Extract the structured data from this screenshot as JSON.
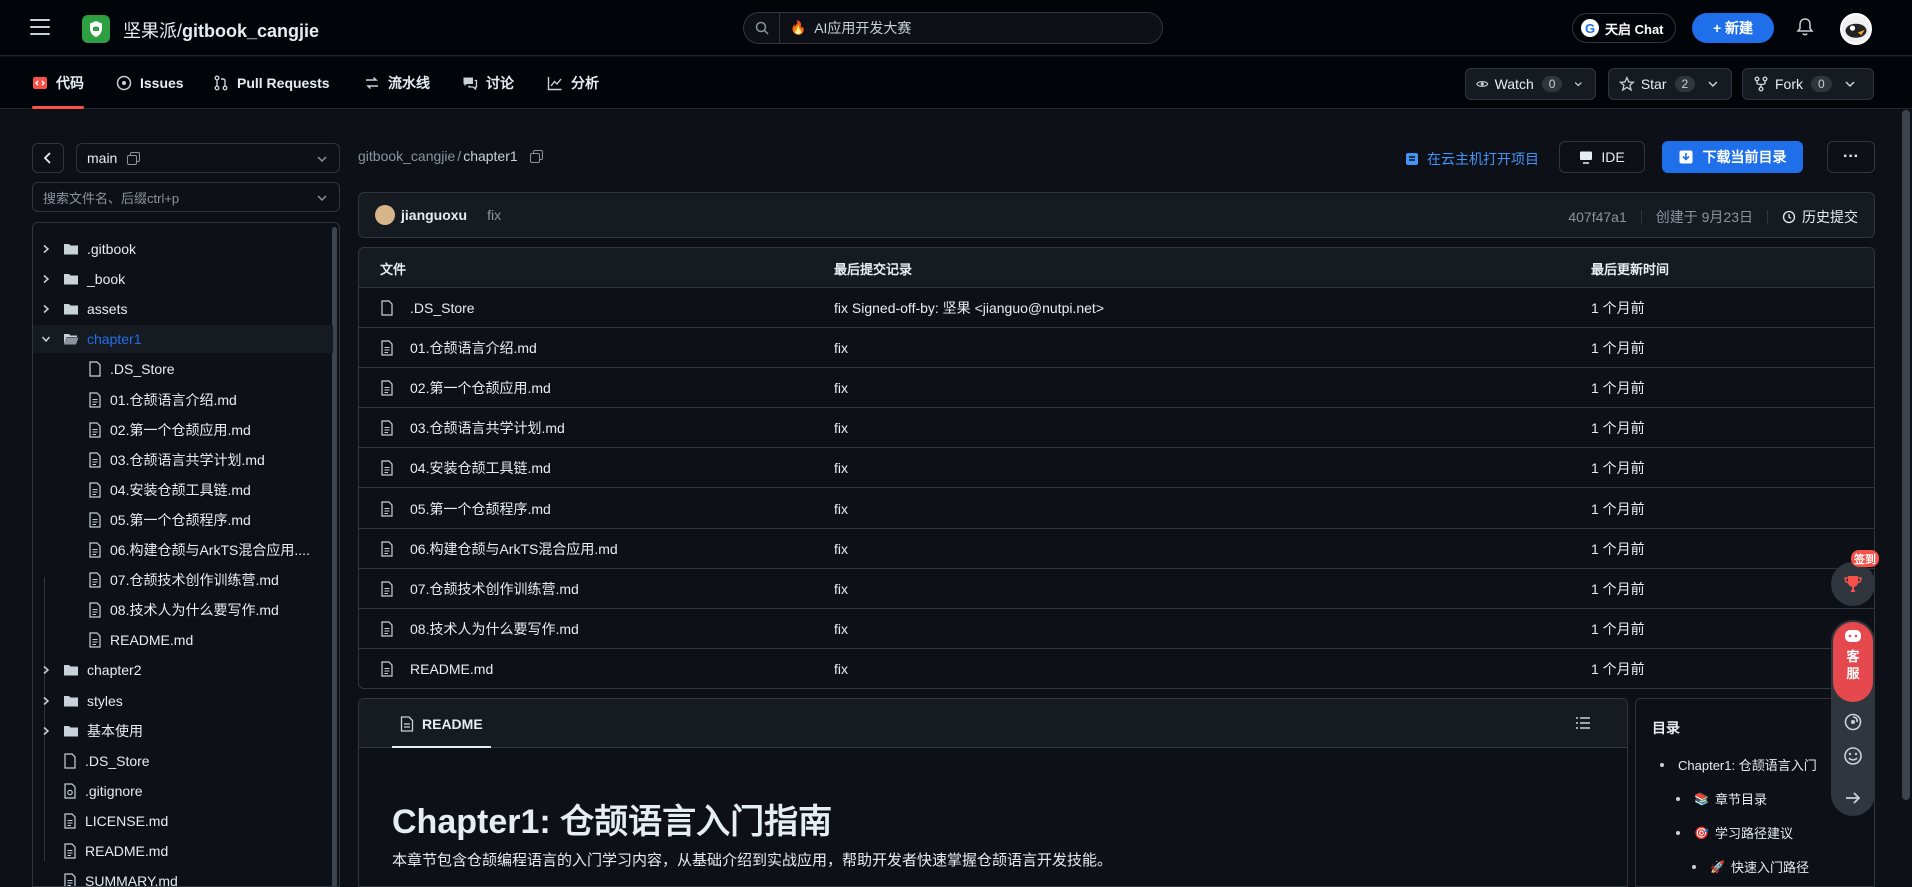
{
  "header": {
    "org": "坚果派",
    "slash": "/",
    "repo": "gitbook_cangjie",
    "search_placeholder": "AI应用开发大赛",
    "chat_label": "天启 Chat",
    "new_label": "+ 新建"
  },
  "subnav": {
    "tabs": [
      {
        "label": "代码",
        "active": true
      },
      {
        "label": "Issues"
      },
      {
        "label": "Pull Requests"
      },
      {
        "label": "流水线"
      },
      {
        "label": "讨论"
      },
      {
        "label": "分析"
      }
    ],
    "watch": {
      "label": "Watch",
      "count": "0"
    },
    "star": {
      "label": "Star",
      "count": "2"
    },
    "fork": {
      "label": "Fork",
      "count": "0"
    }
  },
  "sidebar": {
    "branch": "main",
    "file_search_placeholder": "搜索文件名、后缀ctrl+p",
    "tree": [
      {
        "label": ".gitbook",
        "type": "folder",
        "expanded": false,
        "depth": 0
      },
      {
        "label": "_book",
        "type": "folder",
        "expanded": false,
        "depth": 0
      },
      {
        "label": "assets",
        "type": "folder",
        "expanded": false,
        "depth": 0
      },
      {
        "label": "chapter1",
        "type": "folder",
        "expanded": true,
        "depth": 0
      },
      {
        "label": ".DS_Store",
        "type": "file",
        "depth": 1
      },
      {
        "label": "01.仓颉语言介绍.md",
        "type": "md",
        "depth": 1
      },
      {
        "label": "02.第一个仓颉应用.md",
        "type": "md",
        "depth": 1
      },
      {
        "label": "03.仓颉语言共学计划.md",
        "type": "md",
        "depth": 1
      },
      {
        "label": "04.安装仓颉工具链.md",
        "type": "md",
        "depth": 1
      },
      {
        "label": "05.第一个仓颉程序.md",
        "type": "md",
        "depth": 1
      },
      {
        "label": "06.构建仓颉与ArkTS混合应用....",
        "type": "md",
        "depth": 1
      },
      {
        "label": "07.仓颉技术创作训练营.md",
        "type": "md",
        "depth": 1
      },
      {
        "label": "08.技术人为什么要写作.md",
        "type": "md",
        "depth": 1
      },
      {
        "label": "README.md",
        "type": "md",
        "depth": 1
      },
      {
        "label": "chapter2",
        "type": "folder",
        "expanded": false,
        "depth": 0
      },
      {
        "label": "styles",
        "type": "folder",
        "expanded": false,
        "depth": 0
      },
      {
        "label": "基本使用",
        "type": "folder",
        "expanded": false,
        "depth": 0
      },
      {
        "label": ".DS_Store",
        "type": "file",
        "depth": 0
      },
      {
        "label": ".gitignore",
        "type": "gear",
        "depth": 0
      },
      {
        "label": "LICENSE.md",
        "type": "md",
        "depth": 0
      },
      {
        "label": "README.md",
        "type": "md",
        "depth": 0
      },
      {
        "label": "SUMMARY.md",
        "type": "md",
        "depth": 0
      }
    ]
  },
  "main": {
    "breadcrumb_repo": "gitbook_cangjie",
    "breadcrumb_sep": "/",
    "breadcrumb_dir": "chapter1",
    "cloud_link": "在云主机打开项目",
    "ide_label": "IDE",
    "download_label": "下载当前目录",
    "more_label": "···",
    "commit": {
      "author": "jianguoxu",
      "message": "fix",
      "hash": "407f47a1",
      "created": "创建于 9月23日",
      "history": "历史提交"
    },
    "table": {
      "headers": [
        "文件",
        "最后提交记录",
        "最后更新时间"
      ],
      "rows": [
        {
          "name": ".DS_Store",
          "type": "file",
          "commit": "fix Signed-off-by: 坚果 <jianguo@nutpi.net>",
          "time": "1 个月前"
        },
        {
          "name": "01.仓颉语言介绍.md",
          "type": "md",
          "commit": "fix",
          "time": "1 个月前"
        },
        {
          "name": "02.第一个仓颉应用.md",
          "type": "md",
          "commit": "fix",
          "time": "1 个月前"
        },
        {
          "name": "03.仓颉语言共学计划.md",
          "type": "md",
          "commit": "fix",
          "time": "1 个月前"
        },
        {
          "name": "04.安装仓颉工具链.md",
          "type": "md",
          "commit": "fix",
          "time": "1 个月前"
        },
        {
          "name": "05.第一个仓颉程序.md",
          "type": "md",
          "commit": "fix",
          "time": "1 个月前"
        },
        {
          "name": "06.构建仓颉与ArkTS混合应用.md",
          "type": "md",
          "commit": "fix",
          "time": "1 个月前"
        },
        {
          "name": "07.仓颉技术创作训练营.md",
          "type": "md",
          "commit": "fix",
          "time": "1 个月前"
        },
        {
          "name": "08.技术人为什么要写作.md",
          "type": "md",
          "commit": "fix",
          "time": "1 个月前"
        },
        {
          "name": "README.md",
          "type": "md",
          "commit": "fix",
          "time": "1 个月前"
        }
      ]
    },
    "readme": {
      "tab": "README",
      "title": "Chapter1: 仓颉语言入门指南",
      "intro": "本章节包含仓颉编程语言的入门学习内容，从基础介绍到实战应用，帮助开发者快速掌握仓颉语言开发技能。"
    },
    "toc": {
      "title": "目录",
      "items": [
        {
          "label": "Chapter1: 仓颉语言入门",
          "emoji": "",
          "level": 0
        },
        {
          "label": "章节目录",
          "emoji": "📚",
          "level": 1
        },
        {
          "label": "学习路径建议",
          "emoji": "🎯",
          "level": 1
        },
        {
          "label": "快速入门路径",
          "emoji": "🚀",
          "level": 2
        }
      ]
    }
  },
  "float": {
    "sign_badge": "签到",
    "kefu": [
      "客",
      "服"
    ]
  },
  "colors": {
    "accent": "#1f6feb",
    "active_tab": "#f85149",
    "bg": "#0d1117",
    "panel": "#161b22",
    "border": "#30363d"
  }
}
